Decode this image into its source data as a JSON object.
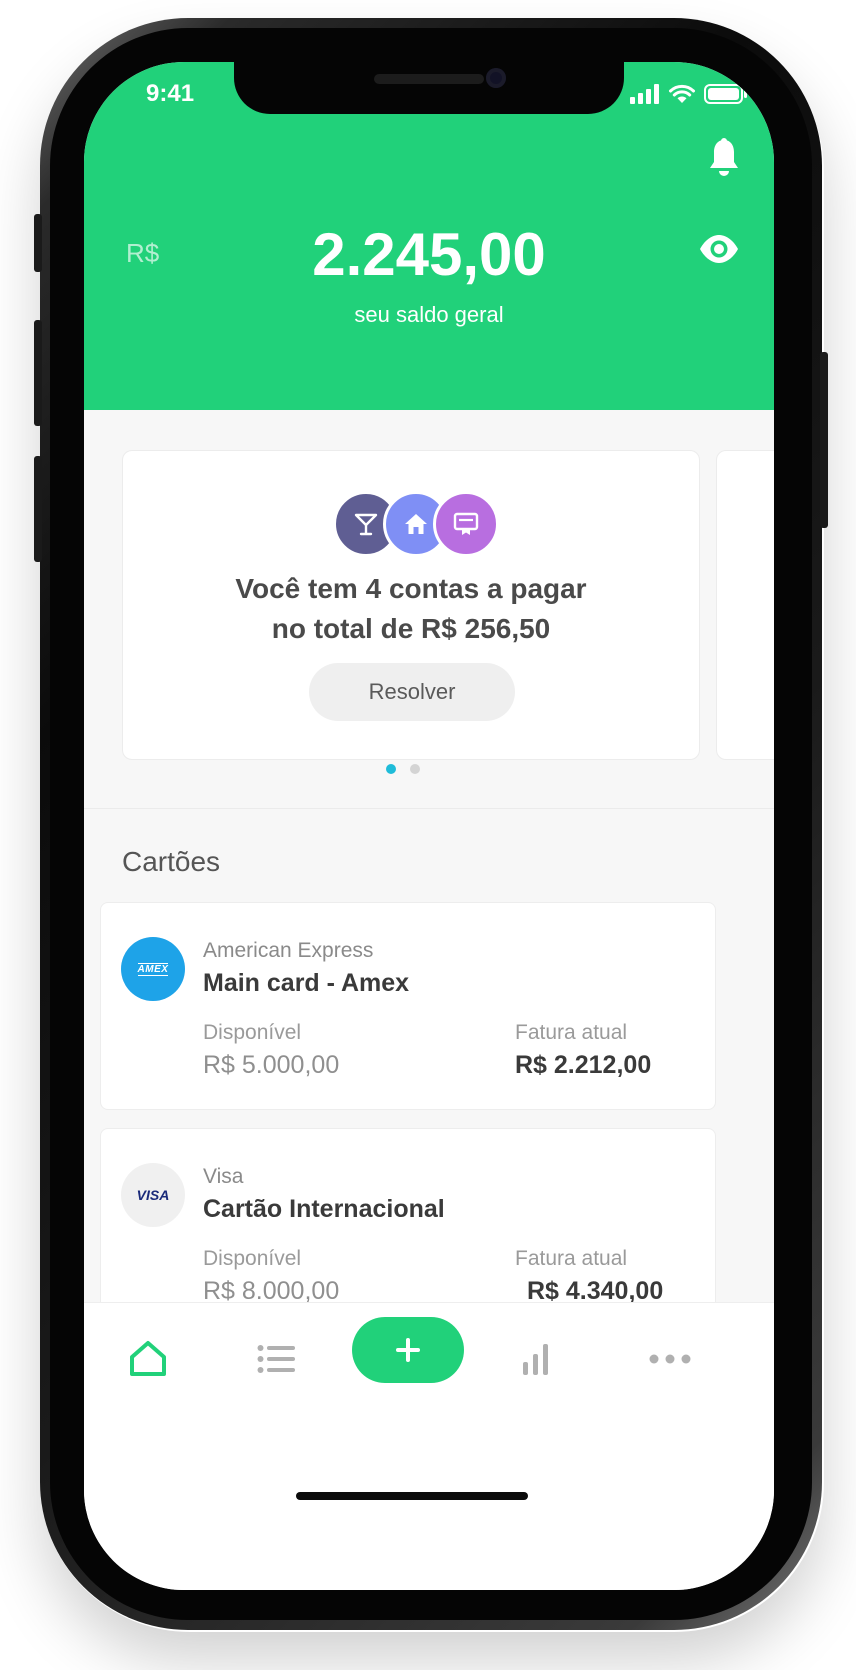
{
  "status_bar": {
    "time": "9:41"
  },
  "header": {
    "currency": "R$",
    "balance": "2.245,00",
    "caption": "seu saldo geral"
  },
  "promo": {
    "line1": "Você tem 4 contas a pagar",
    "line2": "no total de R$ 256,50",
    "button_label": "Resolver",
    "carousel": {
      "pages": 2,
      "active": 1
    }
  },
  "cards_section": {
    "title": "Cartões",
    "items": [
      {
        "brand": "American Express",
        "name": "Main card - Amex",
        "logo_text": "AMEX",
        "available_label": "Disponível",
        "available_value": "R$ 5.000,00",
        "invoice_label": "Fatura atual",
        "invoice_value": "R$ 2.212,00"
      },
      {
        "brand": "Visa",
        "name": "Cartão Internacional",
        "logo_text": "VISA",
        "available_label": "Disponível",
        "available_value": "R$ 8.000,00",
        "invoice_label": "Fatura atual",
        "invoice_value": "R$ 4.340,00"
      }
    ]
  },
  "tab_bar": {
    "items": [
      "home-icon",
      "list-icon",
      "plus-icon",
      "chart-icon",
      "more-icon"
    ],
    "active": "home-icon"
  },
  "colors": {
    "brand_green": "#21d17a",
    "amex_blue": "#1ea3e8",
    "visa_navy": "#1a2a7a",
    "cocktail_purple": "#5f5e93",
    "home_blue": "#7f8ff5",
    "bill_violet": "#b86ee0",
    "dot_active": "#1fbcd9"
  }
}
